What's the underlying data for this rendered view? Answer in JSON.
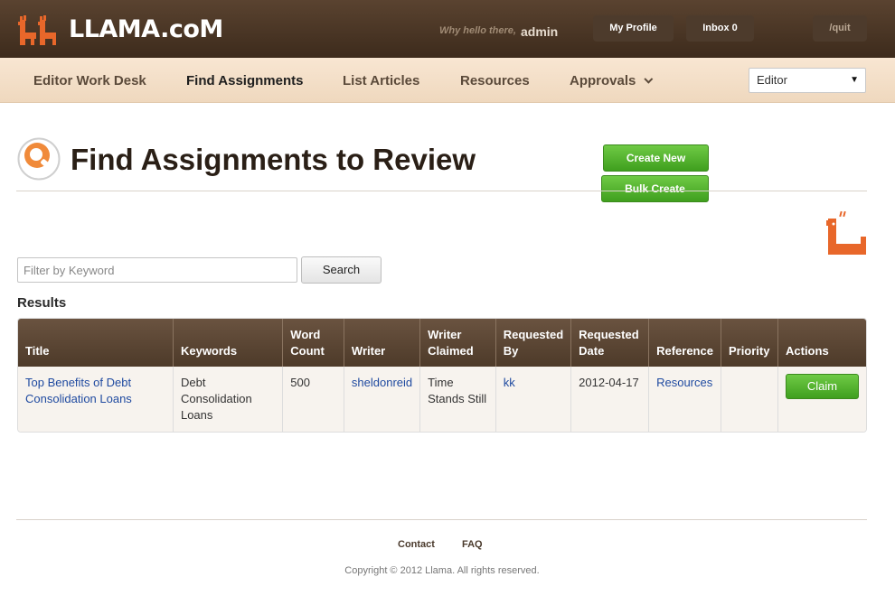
{
  "header": {
    "logo_text": "LLAMA.coM",
    "greeting": "Why hello there,",
    "username": "admin",
    "my_profile": "My Profile",
    "inbox": "Inbox 0",
    "quit": "/quit"
  },
  "nav": {
    "items": [
      {
        "label": "Editor Work Desk"
      },
      {
        "label": "Find Assignments"
      },
      {
        "label": "List Articles"
      },
      {
        "label": "Resources"
      },
      {
        "label": "Approvals"
      }
    ],
    "active": "Find Assignments",
    "role_select_value": "Editor"
  },
  "page": {
    "title": "Find Assignments to Review",
    "create_new": "Create New",
    "bulk_create": "Bulk Create"
  },
  "search": {
    "placeholder": "Filter by Keyword",
    "value": "",
    "button": "Search"
  },
  "results": {
    "label": "Results",
    "columns": [
      "Title",
      "Keywords",
      "Word Count",
      "Writer",
      "Writer Claimed",
      "Requested By",
      "Requested Date",
      "Reference",
      "Priority",
      "Actions"
    ],
    "rows": [
      {
        "title": "Top Benefits of Debt Consolidation Loans",
        "keywords": "Debt Consolidation Loans",
        "word_count": "500",
        "writer": "sheldonreid",
        "writer_claimed": "Time Stands Still",
        "requested_by": "kk",
        "requested_date": "2012-04-17",
        "reference": "Resources",
        "priority": "",
        "action": "Claim"
      }
    ]
  },
  "footer": {
    "contact": "Contact",
    "faq": "FAQ",
    "copyright": "Copyright © 2012 Llama. All rights reserved."
  },
  "colors": {
    "header_brown": "#4a3626",
    "nav_peach": "#f4dfc8",
    "accent_green": "#52b32e",
    "link_blue": "#1f4aa0",
    "brand_orange": "#e8672a"
  }
}
